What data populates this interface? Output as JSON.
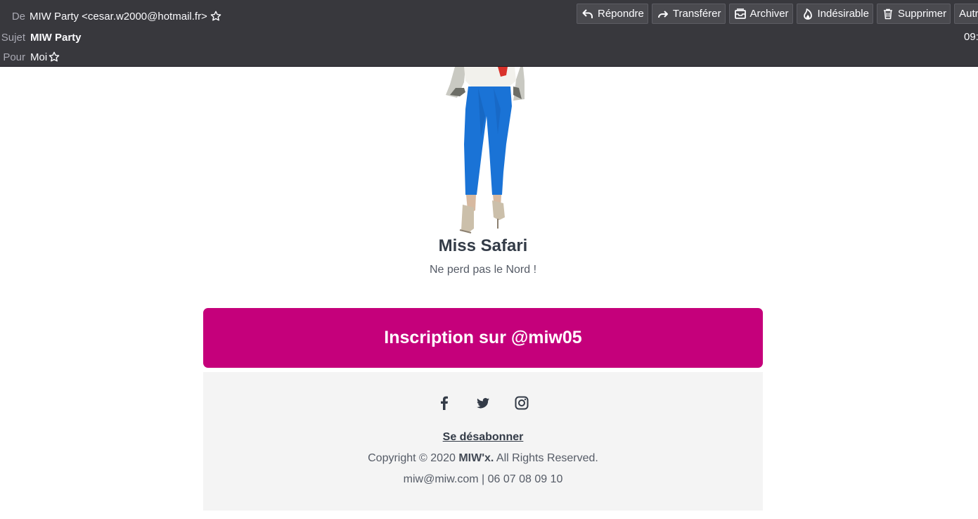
{
  "header": {
    "from_label": "De",
    "from_value": "MIW Party <cesar.w2000@hotmail.fr>",
    "subject_label": "Sujet",
    "subject_value": "MIW Party",
    "to_label": "Pour",
    "to_value": "Moi",
    "time": "09:",
    "icon_star": "star-outline-icon"
  },
  "toolbar": {
    "reply": "Répondre",
    "forward": "Transférer",
    "archive": "Archiver",
    "junk": "Indésirable",
    "delete": "Supprimer",
    "more": "Autres"
  },
  "email": {
    "product_name": "Miss Safari",
    "product_tagline": "Ne perd pas le Nord !",
    "cta_label": "Inscription sur @miw05",
    "unsubscribe": "Se désabonner",
    "copyright_prefix": "Copyright © 2020 ",
    "copyright_brand": "MIW'x.",
    "copyright_suffix": " All Rights Reserved.",
    "contact": "miw@miw.com | 06 07 08 09 10",
    "social_icons": [
      "facebook-icon",
      "twitter-icon",
      "instagram-icon"
    ]
  },
  "colors": {
    "header_bg": "#38383d",
    "cta_bg": "#c5007b",
    "footer_bg": "#f4f4f4",
    "text_dark": "#333b47",
    "pants_blue": "#1a73d6"
  }
}
